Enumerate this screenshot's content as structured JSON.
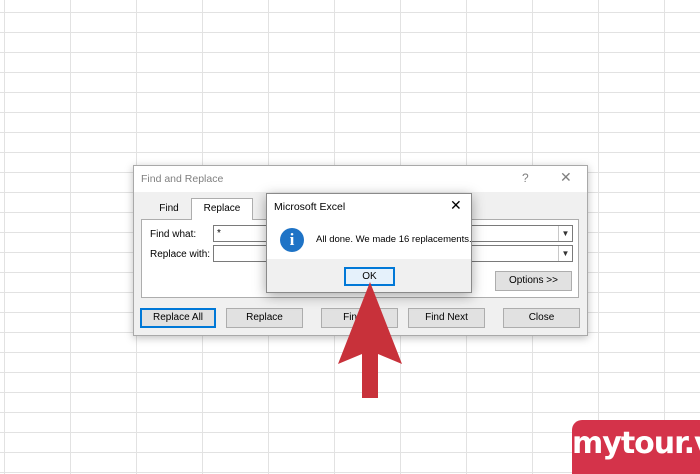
{
  "find_replace": {
    "title": "Find and Replace",
    "help_label": "?",
    "close_label": "✕",
    "tabs": [
      {
        "label": "Find"
      },
      {
        "label": "Replace"
      }
    ],
    "find_what_label": "Find what:",
    "find_what_value": "*",
    "replace_with_label": "Replace with:",
    "replace_with_value": "",
    "options_label": "Options >>",
    "buttons": {
      "replace_all": "Replace All",
      "replace": "Replace",
      "find_all": "Find All",
      "find_next": "Find Next",
      "close": "Close"
    }
  },
  "message_box": {
    "title": "Microsoft Excel",
    "close_label": "✕",
    "icon": "info-icon",
    "icon_glyph": "i",
    "message": "All done. We made 16 replacements.",
    "ok_label": "OK"
  },
  "annotation": {
    "arrow_color": "#c8313a"
  },
  "watermark": {
    "text": "mytour.vn",
    "color": "#d4334a"
  }
}
